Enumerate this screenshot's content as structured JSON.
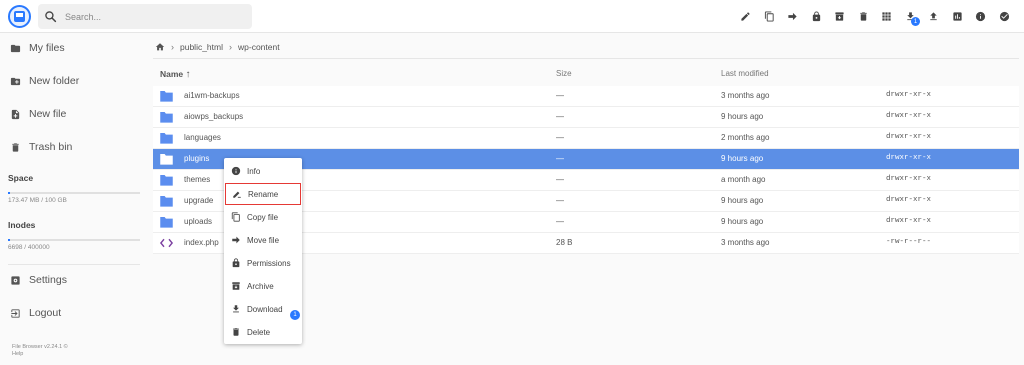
{
  "search": {
    "placeholder": "Search..."
  },
  "toolbar": {
    "buttons": [
      "edit-icon",
      "copy-icon",
      "move-icon",
      "lock-icon",
      "archive-icon",
      "delete-icon",
      "grid-view-icon",
      "download-icon",
      "upload-icon",
      "stats-icon",
      "info-icon",
      "select-check-icon"
    ],
    "download_count": "1"
  },
  "sidebar": {
    "items": [
      {
        "label": "My files",
        "icon": "folder-icon"
      },
      {
        "label": "New folder",
        "icon": "new-folder-icon"
      },
      {
        "label": "New file",
        "icon": "new-file-icon"
      },
      {
        "label": "Trash bin",
        "icon": "trash-icon"
      }
    ],
    "space_label": "Space",
    "space_value": "173.47 MB / 100 GB",
    "space_fraction": 0.0017,
    "inodes_label": "Inodes",
    "inodes_value": "6698 / 400000",
    "inodes_fraction": 0.0167,
    "settings_label": "Settings",
    "logout_label": "Logout",
    "footer": {
      "version": "File Browser v2.24.1 ©",
      "help": "Help"
    }
  },
  "breadcrumb": {
    "items": [
      "public_html",
      "wp-content"
    ]
  },
  "list": {
    "headers": {
      "name": "Name",
      "size": "Size",
      "modified": "Last modified"
    },
    "rows": [
      {
        "type": "folder",
        "name": "ai1wm-backups",
        "size": "—",
        "modified": "3 months ago",
        "perm": "drwxr-xr-x"
      },
      {
        "type": "folder",
        "name": "aiowps_backups",
        "size": "—",
        "modified": "9 hours ago",
        "perm": "drwxr-xr-x"
      },
      {
        "type": "folder",
        "name": "languages",
        "size": "—",
        "modified": "2 months ago",
        "perm": "drwxr-xr-x"
      },
      {
        "type": "folder",
        "name": "plugins",
        "size": "—",
        "modified": "9 hours ago",
        "perm": "drwxr-xr-x",
        "selected": true
      },
      {
        "type": "folder",
        "name": "themes",
        "size": "—",
        "modified": "a month ago",
        "perm": "drwxr-xr-x"
      },
      {
        "type": "folder",
        "name": "upgrade",
        "size": "—",
        "modified": "9 hours ago",
        "perm": "drwxr-xr-x"
      },
      {
        "type": "folder",
        "name": "uploads",
        "size": "—",
        "modified": "9 hours ago",
        "perm": "drwxr-xr-x"
      },
      {
        "type": "code",
        "name": "index.php",
        "size": "28 B",
        "modified": "3 months ago",
        "perm": "-rw-r--r--"
      }
    ]
  },
  "context_menu": {
    "items": [
      {
        "label": "Info",
        "icon": "info-icon"
      },
      {
        "label": "Rename",
        "icon": "rename-icon",
        "highlighted": true
      },
      {
        "label": "Copy file",
        "icon": "copy-icon"
      },
      {
        "label": "Move file",
        "icon": "move-icon"
      },
      {
        "label": "Permissions",
        "icon": "lock-icon"
      },
      {
        "label": "Archive",
        "icon": "archive-icon"
      },
      {
        "label": "Download",
        "icon": "download-icon"
      },
      {
        "label": "Delete",
        "icon": "delete-icon"
      }
    ],
    "download_count": "1"
  },
  "colors": {
    "accent": "#2979ff",
    "selected_row": "#5c8fe6",
    "folder": "#5b8def",
    "highlight_border": "#e53935"
  }
}
